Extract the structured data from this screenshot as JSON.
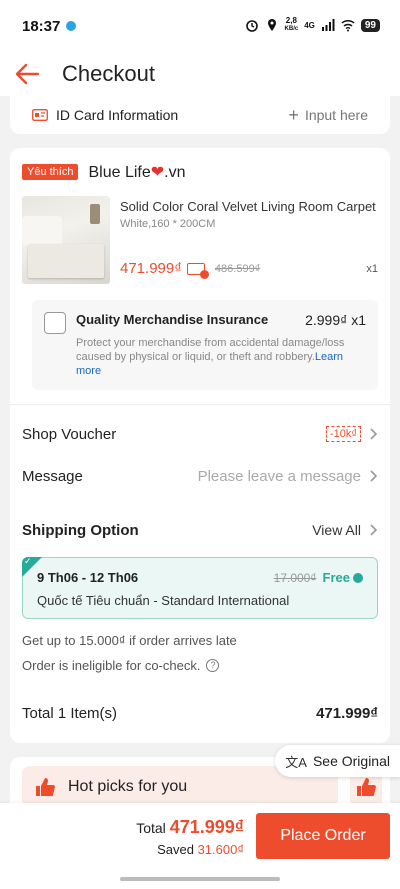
{
  "status_bar": {
    "time": "18:37",
    "speed_top": "2,8",
    "speed_unit": "KB/c",
    "network": "4G",
    "battery": "99"
  },
  "header": {
    "title": "Checkout"
  },
  "id_card": {
    "label": "ID Card Information",
    "action": "Input here"
  },
  "shop": {
    "badge": "Yêu thích",
    "name": "Blue Life",
    "name_suffix": ".vn",
    "product": {
      "name": "Solid Color Coral Velvet Living Room Carpet",
      "variant": "White,160 * 200CM",
      "price": "471.999₫",
      "old_price": "486.599₫",
      "qty": "x1"
    },
    "insurance": {
      "title": "Quality Merchandise Insurance",
      "price": "2.999₫ x1",
      "desc": "Protect your merchandise from accidental damage/loss caused by physical or liquid, or theft and robbery.",
      "learn_more": "Learn more"
    },
    "voucher": {
      "label": "Shop Voucher",
      "tag": "-10k₫"
    },
    "message": {
      "label": "Message",
      "placeholder": "Please leave a message"
    },
    "shipping": {
      "title": "Shipping Option",
      "view_all": "View All",
      "dates": "9 Th06 - 12 Th06",
      "old_fee": "17.000₫",
      "fee": "Free",
      "method": "Quốc tế Tiêu chuẩn - Standard International"
    },
    "late_note": "Get up to 15.000₫ if order arrives late",
    "cocheck_note": "Order is ineligible for co-check.",
    "total_label": "Total 1 Item(s)",
    "total_value": "471.999₫"
  },
  "hot_picks": {
    "label": "Hot picks for you"
  },
  "see_original": {
    "label": "See Original"
  },
  "footer": {
    "total_label": "Total",
    "total_value": "471.999₫",
    "saved_label": "Saved",
    "saved_value": "31.600₫",
    "place_order": "Place Order"
  },
  "colors": {
    "accent": "#ee4d2d",
    "shipping_green": "#26aa99",
    "link_blue": "#1a66cc"
  },
  "icons": [
    "back-arrow-icon",
    "id-card-icon",
    "plus-icon",
    "heart-icon",
    "voucher-icon",
    "chevron-right-icon",
    "check-icon",
    "question-icon",
    "thumb-up-icon",
    "translate-icon"
  ]
}
